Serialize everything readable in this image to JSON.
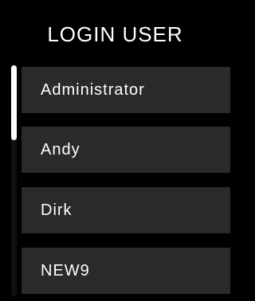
{
  "header": {
    "title": "LOGIN USER"
  },
  "users": [
    {
      "label": "Administrator"
    },
    {
      "label": "Andy"
    },
    {
      "label": "Dirk"
    },
    {
      "label": "NEW9"
    }
  ],
  "colors": {
    "background": "#000000",
    "item_background": "#2a2a2a",
    "text": "#ffffff",
    "scrollbar_thumb": "#ffffff"
  }
}
